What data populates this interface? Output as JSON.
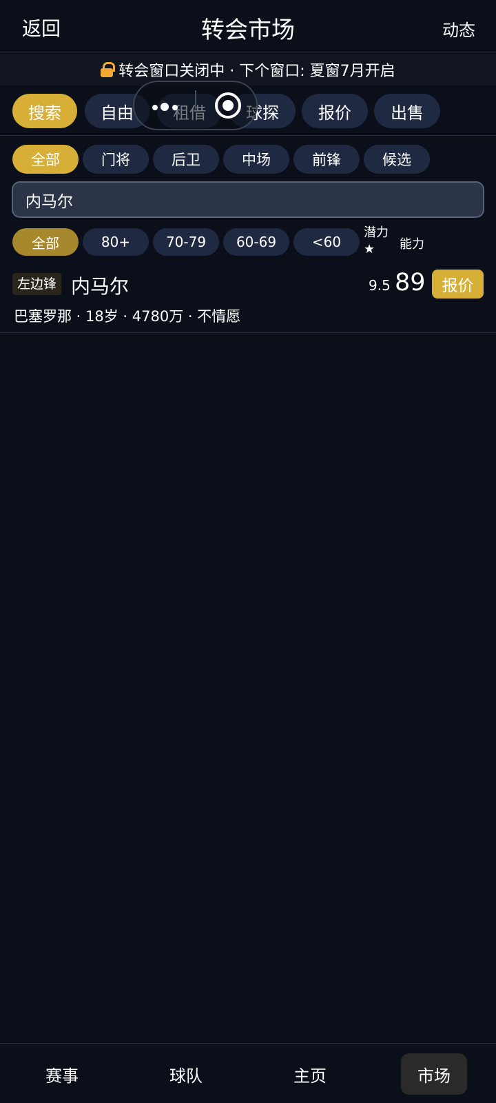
{
  "header": {
    "back_label": "返回",
    "title": "转会市场",
    "news_label": "动态"
  },
  "notice": {
    "icon": "lock-icon",
    "text": "转会窗口关闭中 · 下个窗口: 夏窗7月开启"
  },
  "tabs": [
    {
      "label": "搜索",
      "active": true
    },
    {
      "label": "自由",
      "active": false
    },
    {
      "label": "租借",
      "active": false
    },
    {
      "label": "球探",
      "active": false
    },
    {
      "label": "报价",
      "active": false
    },
    {
      "label": "出售",
      "active": false
    }
  ],
  "position_filters": [
    {
      "label": "全部",
      "active": true
    },
    {
      "label": "门将",
      "active": false
    },
    {
      "label": "后卫",
      "active": false
    },
    {
      "label": "中场",
      "active": false
    },
    {
      "label": "前锋",
      "active": false
    },
    {
      "label": "候选",
      "active": false
    }
  ],
  "search": {
    "value": "内马尔"
  },
  "rating_filters": [
    {
      "label": "全部",
      "active": true
    },
    {
      "label": "80+",
      "active": false
    },
    {
      "label": "70-79",
      "active": false
    },
    {
      "label": "60-69",
      "active": false
    },
    {
      "label": "<60",
      "active": false
    }
  ],
  "sort": {
    "potential_label": "潜力★",
    "ability_label": "能力"
  },
  "players": [
    {
      "position": "左边锋",
      "name": "内马尔",
      "potential": "9.5",
      "rating": "89",
      "offer_label": "报价",
      "meta": "巴塞罗那 · 18岁 · 4780万 · 不情愿"
    }
  ],
  "overlay": {
    "more_icon": "more-icon",
    "record_icon": "record-icon"
  },
  "bottom_nav": [
    {
      "label": "赛事",
      "active": false
    },
    {
      "label": "球队",
      "active": false
    },
    {
      "label": "主页",
      "active": false
    },
    {
      "label": "市场",
      "active": true
    }
  ],
  "colors": {
    "background": "#0b0f1a",
    "accent": "#d7af36",
    "chip": "#1f2941",
    "lock": "#f0a830"
  }
}
